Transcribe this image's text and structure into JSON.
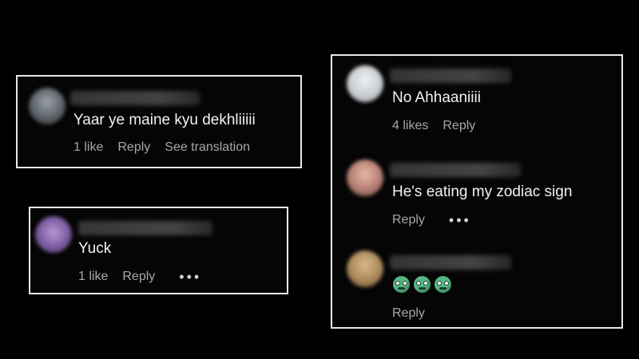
{
  "cards": [
    {
      "comments": [
        {
          "text": "Yaar ye maine kyu dekhliiiii",
          "likes": "1 like",
          "reply": "Reply",
          "extra": "See translation"
        }
      ]
    },
    {
      "comments": [
        {
          "text": "Yuck",
          "likes": "1 like",
          "reply": "Reply",
          "more": "•••"
        }
      ]
    },
    {
      "comments": [
        {
          "text": "No Ahhaaniiii",
          "likes": "4 likes",
          "reply": "Reply"
        },
        {
          "text": "He's eating my zodiac sign",
          "reply": "Reply",
          "more": "•••"
        },
        {
          "emoji_icons": [
            "nauseated-face-icon",
            "nauseated-face-icon",
            "nauseated-face-icon"
          ],
          "reply": "Reply"
        }
      ]
    }
  ],
  "colors": {
    "background": "#000000",
    "card_border": "#e8e8e8",
    "text_primary": "#f2f2f2",
    "text_secondary": "#a8a8a8"
  }
}
